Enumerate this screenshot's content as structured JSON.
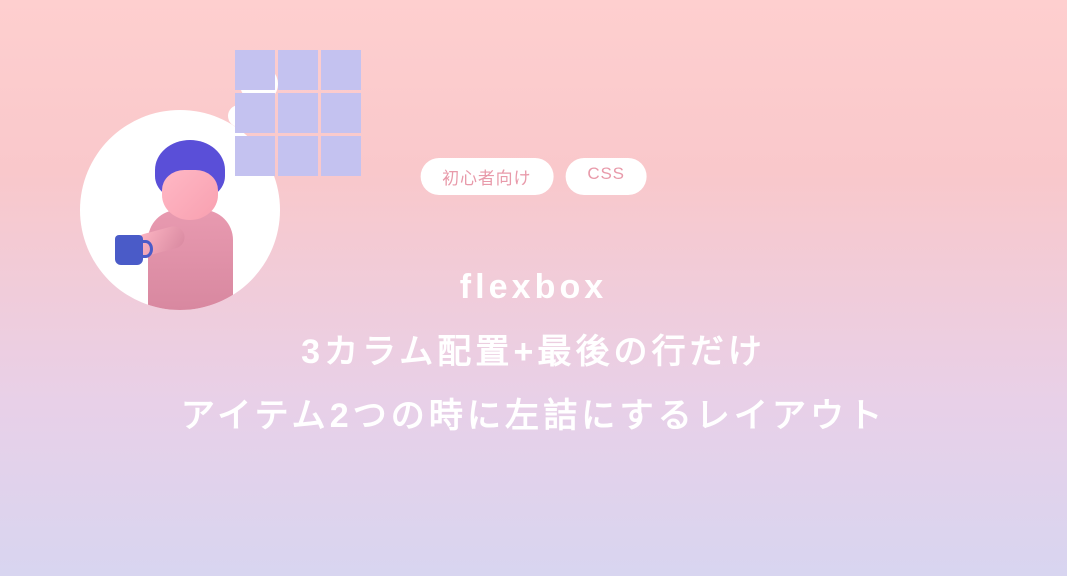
{
  "badges": [
    {
      "label": "初心者向け"
    },
    {
      "label": "CSS"
    }
  ],
  "title": {
    "line1": "flexbox",
    "line2": "3カラム配置+最後の行だけ",
    "line3": "アイテム2つの時に左詰にするレイアウト"
  }
}
